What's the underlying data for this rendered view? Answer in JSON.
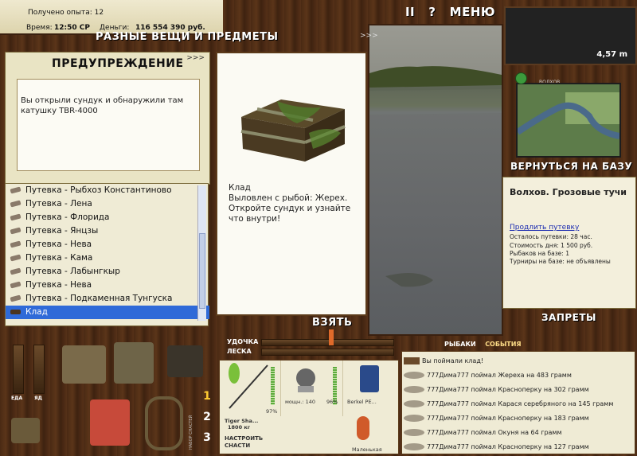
{
  "stats": {
    "exp_label": "Получено опыта:",
    "exp_value": "12",
    "time_label": "Время:",
    "time_value": "12:50 СР",
    "money_label": "Деньги:",
    "money_value": "116 554 390 руб."
  },
  "top_menu": {
    "pause": "II",
    "help": "?",
    "menu": "МЕНЮ"
  },
  "depth": "4,57 m",
  "items_panel": {
    "title": "РАЗНЫЕ ВЕЩИ И ПРЕДМЕТЫ",
    "arrows": ">>>",
    "warning_title": "ПРЕДУПРЕЖДЕНИЕ",
    "warning_arrows": ">>>",
    "warning_message": "Вы открыли сундук и обнаружили там катушку TBR-4000",
    "list": [
      "Путевка - Рыбхоз Константиново",
      "Путевка - Лена",
      "Путевка - Флорида",
      "Путевка - Янцзы",
      "Путевка - Нева",
      "Путевка - Кама",
      "Путевка - Лабынгкыр",
      "Путевка - Нева",
      "Путевка - Подкаменная Тунгуска",
      "Клад"
    ],
    "selected_index": 9,
    "detail": {
      "name": "Клад",
      "line1": "Выловлен с рыбой: Жерех.",
      "line2": "Откройте сундук и узнайте что внутри!"
    },
    "take_button": "ВЗЯТЬ"
  },
  "map_header": "ВОЛХОВ",
  "return_button": "ВЕРНУТЬСЯ НА БАЗУ",
  "location": {
    "name": "Волхов. Грозовые тучи",
    "extend_link": "Продлить путевку",
    "remaining": "Осталось путевки: 28 час.",
    "day_cost": "Стоимость дня: 1 500 руб.",
    "anglers": "Рыбаков на базе: 1",
    "tournaments": "Турниры на базе: не объявлены"
  },
  "bans_button": "ЗАПРЕТЫ",
  "rod_labels": {
    "rod": "УДОЧКА",
    "line": "ЛЕСКА"
  },
  "gear": {
    "rod_percent": "97%",
    "reel_label": "мощн.: 140",
    "reel_percent": "96%",
    "line_label": "Berkel PE...",
    "rod_name": "Tiger Sha...",
    "rod_weight": "1800 кг",
    "lure_label": "Маленькая",
    "tune_line1": "НАСТРОИТЬ",
    "tune_line2": "СНАСТИ"
  },
  "slots": [
    "1",
    "2",
    "3"
  ],
  "slot_caption": "НАБОР СНАСТЕЙ",
  "left_bars": {
    "food": "ЕДА",
    "poison": "ЯД"
  },
  "tabs": {
    "anglers": "РЫБАКИ",
    "events": "СОБЫТИЯ"
  },
  "log": [
    "Вы поймали клад!",
    "777Дима777 поймал Жереха на 483 грамм",
    "777Дима777 поймал Красноперку на 302 грамм",
    "777Дима777 поймал Карася серебряного на 145 грамм",
    "777Дима777 поймал Красноперку на 183 грамм",
    "777Дима777 поймал Окуня на 64 грамм",
    "777Дима777 поймал Красноперку на 127 грамм"
  ],
  "colors": {
    "selection": "#2f6ad8",
    "link": "#1a2ab0",
    "header_text": "#ffffff"
  }
}
